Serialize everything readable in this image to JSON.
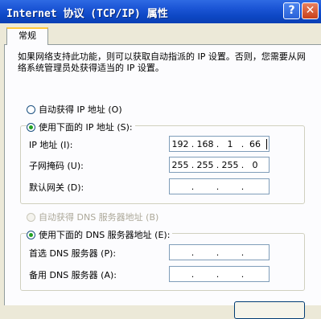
{
  "window": {
    "title": "Internet 协议 (TCP/IP) 属性",
    "help": "?",
    "close": "✕"
  },
  "tabs": [
    {
      "label": "常规"
    }
  ],
  "description": "如果网络支持此功能，则可以获取自动指派的 IP 设置。否则，您需要从网络系统管理员处获得适当的 IP 设置。",
  "ip_section": {
    "auto": {
      "label": "自动获得 IP 地址 (O)",
      "checked": false
    },
    "manual": {
      "label": "使用下面的 IP 地址 (S):",
      "checked": true
    },
    "fields": [
      {
        "label": "IP 地址 (I):",
        "octets": [
          "192",
          "168",
          "1",
          "66"
        ]
      },
      {
        "label": "子网掩码 (U):",
        "octets": [
          "255",
          "255",
          "255",
          "0"
        ]
      },
      {
        "label": "默认网关 (D):",
        "octets": [
          "",
          "",
          "",
          ""
        ]
      }
    ]
  },
  "dns_section": {
    "auto": {
      "label": "自动获得 DNS 服务器地址 (B)",
      "checked": false,
      "disabled": true
    },
    "manual": {
      "label": "使用下面的 DNS 服务器地址 (E):",
      "checked": true
    },
    "fields": [
      {
        "label": "首选 DNS 服务器 (P):",
        "octets": [
          "",
          "",
          "",
          ""
        ]
      },
      {
        "label": "备用 DNS 服务器 (A):",
        "octets": [
          "",
          "",
          "",
          ""
        ]
      }
    ]
  },
  "colors": {
    "titlebar": "#0d47c4",
    "accent_tab": "#ffc83c",
    "radio_check": "#21a121"
  }
}
